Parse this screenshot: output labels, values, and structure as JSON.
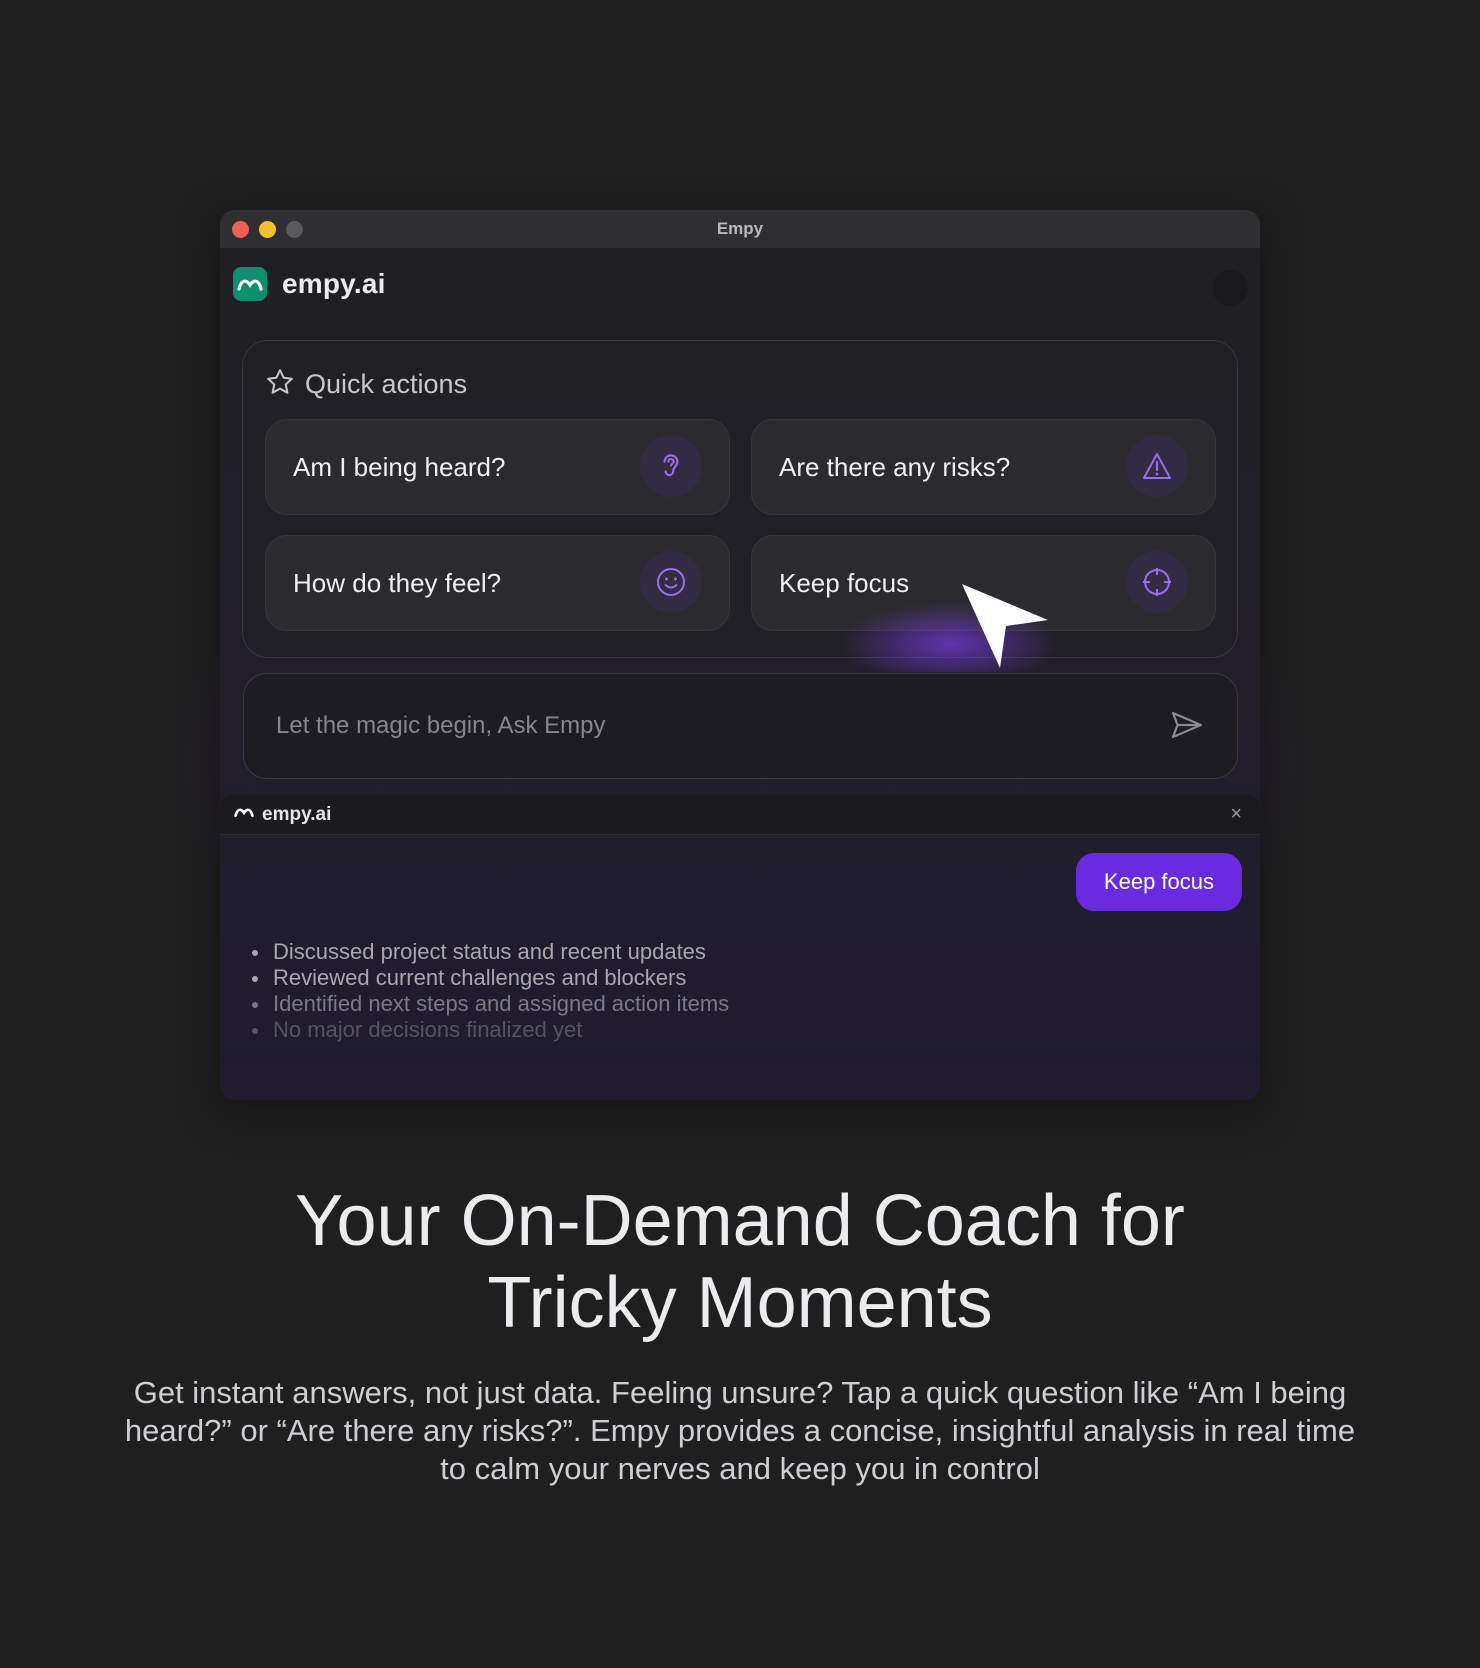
{
  "window": {
    "title": "Empy"
  },
  "app": {
    "brand": "empy.ai"
  },
  "quick_actions": {
    "title": "Quick actions",
    "items": [
      {
        "label": "Am I being heard?",
        "icon": "ear-icon"
      },
      {
        "label": "Are there any risks?",
        "icon": "warning-triangle-icon"
      },
      {
        "label": "How do they feel?",
        "icon": "smile-icon"
      },
      {
        "label": "Keep focus",
        "icon": "crosshair-icon"
      }
    ]
  },
  "input": {
    "placeholder": "Let the magic begin, Ask Empy"
  },
  "summary_panel": {
    "brand": "empy.ai",
    "close": "×",
    "chip": "Keep focus",
    "bullets": [
      "Discussed project status and recent updates",
      "Reviewed current challenges and blockers",
      "Identified next steps and assigned action items",
      "No major decisions finalized yet"
    ]
  },
  "marketing": {
    "headline_line1": "Your On-Demand Coach for",
    "headline_line2": "Tricky Moments",
    "description": "Get instant answers, not just data. Feeling unsure? Tap a quick question like “Am I being heard?” or “Are there any risks?”. Empy provides a concise, insightful analysis in real time to calm your nerves and keep you in control"
  },
  "colors": {
    "background": "#1f1f20",
    "accent": "#6a2be0",
    "logo": "#0f8f6f",
    "icon_purple": "#9b6cf0"
  }
}
